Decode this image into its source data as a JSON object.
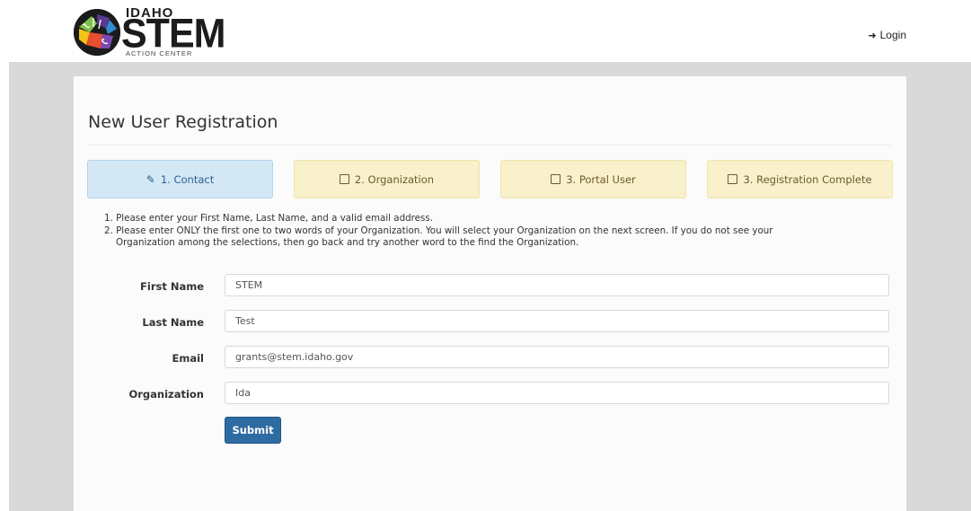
{
  "header": {
    "logo_top": "IDAHO",
    "logo_main": "STEM",
    "logo_sub": "ACTION CENTER",
    "login_label": "Login"
  },
  "page": {
    "title": "New User Registration"
  },
  "steps": [
    {
      "label": "1. Contact",
      "state": "active",
      "icon": "edit-icon"
    },
    {
      "label": "2. Organization",
      "state": "pending",
      "icon": "checkbox-icon"
    },
    {
      "label": "3. Portal User",
      "state": "pending",
      "icon": "checkbox-icon"
    },
    {
      "label": "3. Registration Complete",
      "state": "pending",
      "icon": "checkbox-icon"
    }
  ],
  "instructions": {
    "line1": "1. Please enter your First Name, Last Name, and a valid email address.",
    "line2": "2. Please enter ONLY the first one to two words of your Organization. You will select your Organization on the next screen. If you do not see your",
    "line2_cont": "Organization among the selections, then go back and try another word to the find the Organization."
  },
  "form": {
    "first_name": {
      "label": "First Name",
      "value": "STEM"
    },
    "last_name": {
      "label": "Last Name",
      "value": "Test"
    },
    "email": {
      "label": "Email",
      "value": "grants@stem.idaho.gov"
    },
    "organization": {
      "label": "Organization",
      "value": "Ida"
    },
    "submit_label": "Submit"
  },
  "colors": {
    "active_step_bg": "#d4e7f5",
    "pending_step_bg": "#f9f0cc",
    "submit_bg": "#2f6ba3",
    "backdrop": "#d9d9d9"
  }
}
